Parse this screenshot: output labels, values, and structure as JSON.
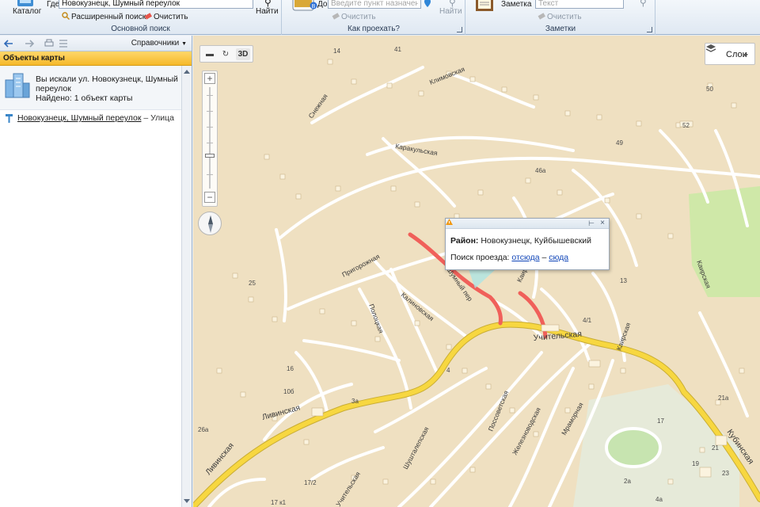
{
  "ribbon": {
    "catalog_label": "Каталог",
    "where_label": "Где",
    "where_value": "Новокузнецк, Шумный переулок",
    "find_label": "Найти",
    "advanced_search_label": "Расширенный поиск",
    "clear_label": "Очистить",
    "search_group_caption": "Основной поиск",
    "to_label": "До",
    "to_placeholder": "Введите пункт назначения",
    "route_clear_label": "Очистить",
    "route_find_label": "Найти",
    "route_group_caption": "Как проехать?",
    "note_label": "Заметка",
    "note_placeholder": "Текст",
    "note_clear_label": "Очистить",
    "notes_group_caption": "Заметки"
  },
  "left_panel": {
    "directories_label": "Справочники",
    "header": "Объекты карты",
    "summary_line1": "Вы искали ул. Новокузнецк, Шумный",
    "summary_line2": "переулок",
    "summary_found": "Найдено: 1 объект карты",
    "result_name": "Новокузнецк, Шумный переулок",
    "result_separator": " – ",
    "result_type": "Улица"
  },
  "map": {
    "mode_3d": "3D",
    "layers_label": "Слои",
    "popup": {
      "district_label": "Район:",
      "district_value": "Новокузнецк, Куйбышевский",
      "route_label": "Поиск проезда:",
      "from_link": "отсюда",
      "dash": "–",
      "to_link": "сюда"
    },
    "streets": [
      "Климовская",
      "Снежная",
      "Каракульская",
      "Пригорожная",
      "Калиновская",
      "Полоцкая",
      "Учительская",
      "Ливинская",
      "Поссоветская",
      "Железноводская",
      "Мраморная",
      "Кубинская",
      "Каирская",
      "Шумный пер",
      "Шушталепская",
      "Каир"
    ],
    "house_numbers": [
      "14",
      "41",
      "50",
      "52",
      "49",
      "46а",
      "25",
      "13",
      "4/1",
      "16",
      "10б",
      "3а",
      "26а",
      "21а",
      "17",
      "19",
      "21",
      "23",
      "2а",
      "4а",
      "17/2",
      "17 к1",
      "4"
    ],
    "route_color": "#f0605a",
    "main_road_color": "#f7d740",
    "park_color": "#cfe8a8"
  }
}
